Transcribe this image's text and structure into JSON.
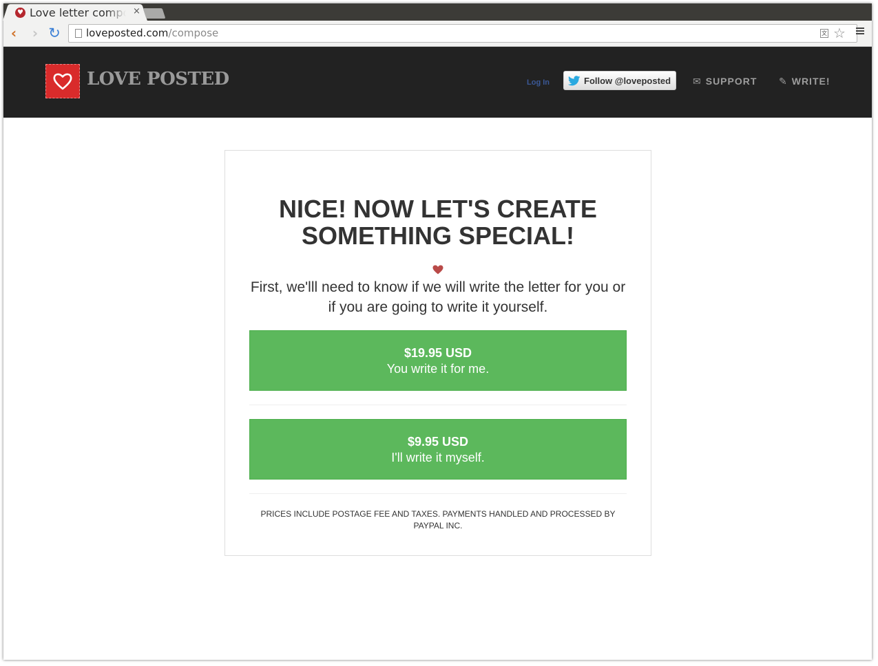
{
  "browser": {
    "tab_title": "Love letter compose",
    "tab_close": "×",
    "url_host": "loveposted.com",
    "url_path": "/compose"
  },
  "header": {
    "logo_text": "LOVE POSTED",
    "login_label": "Log In",
    "twitter_label": "Follow @loveposted",
    "support_label": "SUPPORT",
    "write_label": "WRITE!"
  },
  "main": {
    "title": "NICE! NOW LET'S CREATE SOMETHING SPECIAL!",
    "intro": "First, we'lll need to know if we will write the letter for you or if you are going to write it yourself.",
    "options": [
      {
        "price": "$19.95 USD",
        "description": "You write it for me."
      },
      {
        "price": "$9.95 USD",
        "description": "I'll write it myself."
      }
    ],
    "footnote": "PRICES INCLUDE POSTAGE FEE AND TAXES. PAYMENTS HANDLED AND PROCESSED BY PAYPAL INC."
  },
  "colors": {
    "header_bg": "#222222",
    "logo_red": "#d92b2b",
    "button_green": "#5cb85c",
    "heart": "#b94a48",
    "text": "#333333"
  },
  "icons": {
    "favicon": "heart-icon",
    "back": "back-arrow-icon",
    "forward": "forward-arrow-icon",
    "reload": "reload-icon",
    "bookmark": "star-icon",
    "menu": "hamburger-menu-icon",
    "support": "envelope-icon",
    "write": "pencil-icon",
    "twitter": "twitter-bird-icon"
  }
}
